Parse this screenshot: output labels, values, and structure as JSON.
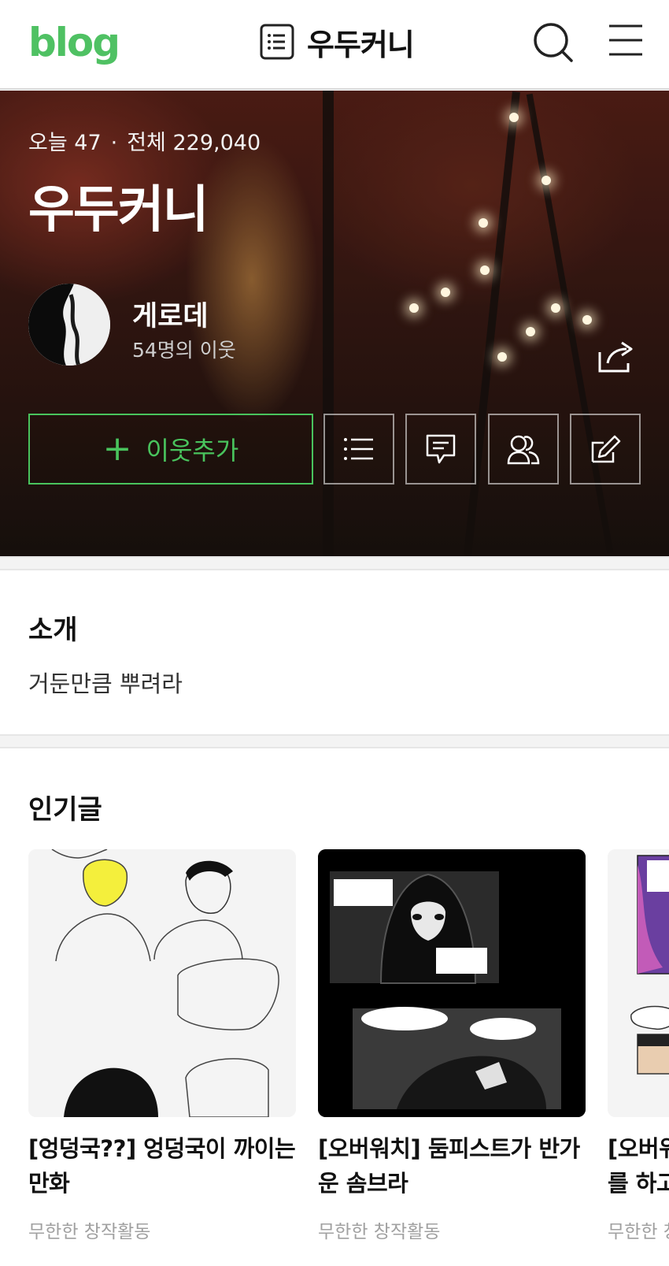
{
  "header": {
    "logo": "blog",
    "title": "우두커니"
  },
  "hero": {
    "stats_today": "오늘 47",
    "stats_separator": "·",
    "stats_total": "전체 229,040",
    "blog_title": "우두커니",
    "nickname": "게로데",
    "neighbors": "54명의 이웃",
    "add_neighbor_label": "이웃추가",
    "add_neighbor_plus": "+"
  },
  "intro": {
    "heading": "소개",
    "text": "거둔만큼 뿌려라"
  },
  "popular": {
    "heading": "인기글",
    "posts": [
      {
        "title": "[엉덩국??] 엉덩국이 까이는 만화",
        "category": "무한한 창작활동"
      },
      {
        "title": "[오버워치] 둠피스트가 반가운 솜브라",
        "category": "무한한 창작활동"
      },
      {
        "title": "[오버워치] 여섯번째 이야기를 하고 온 메르시",
        "category": "무한한 창작활동"
      }
    ]
  },
  "colors": {
    "brand_green": "#4fc163",
    "button_green": "#49c35d"
  },
  "icons": [
    "list-icon",
    "search-icon",
    "menu-icon",
    "share-icon",
    "post-list-icon",
    "comment-icon",
    "neighbors-icon",
    "write-icon"
  ]
}
